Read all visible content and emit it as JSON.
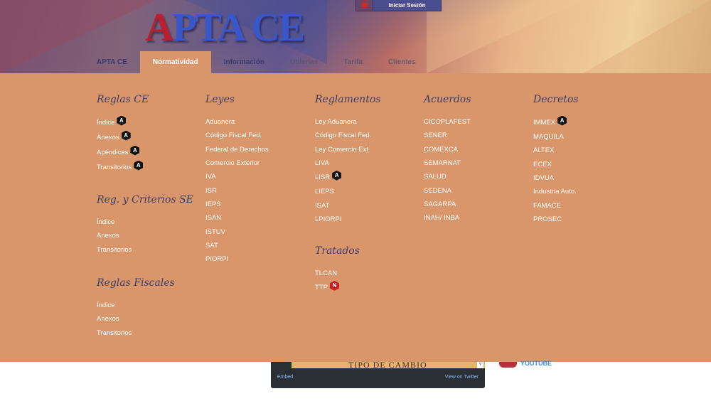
{
  "brand": {
    "logo_first": "A",
    "logo_rest": "PTA CE"
  },
  "login": {
    "label": "Iniciar Sesión",
    "icon": "lock-icon"
  },
  "nav": [
    {
      "label": "APTA CE",
      "state": "normal"
    },
    {
      "label": "Normatividad",
      "state": "active"
    },
    {
      "label": "Información",
      "state": "normal"
    },
    {
      "label": "Utilerías",
      "state": "faded"
    },
    {
      "label": "Tarifa",
      "state": "faded"
    },
    {
      "label": "Clientes",
      "state": "faded"
    }
  ],
  "menu": {
    "reglas_ce": {
      "title": "Reglas CE",
      "items": [
        {
          "label": "Índice",
          "badge": "A"
        },
        {
          "label": "Anexos",
          "badge": "A"
        },
        {
          "label": "Apéndices",
          "badge": "A"
        },
        {
          "label": "Transitorios",
          "badge": "A"
        }
      ]
    },
    "reg_criterios": {
      "title": "Reg. y Criterios SE",
      "items": [
        {
          "label": "Índice"
        },
        {
          "label": "Anexos"
        },
        {
          "label": "Transitorios"
        }
      ]
    },
    "reglas_fiscales": {
      "title": "Reglas Fiscales",
      "items": [
        {
          "label": "Índice"
        },
        {
          "label": "Anexos"
        },
        {
          "label": "Transitorios"
        }
      ]
    },
    "leyes": {
      "title": "Leyes",
      "items": [
        {
          "label": "Aduanera"
        },
        {
          "label": "Código Fiscal Fed."
        },
        {
          "label": "Federal de Derechos"
        },
        {
          "label": "Comercio Exterior"
        },
        {
          "label": "IVA"
        },
        {
          "label": "ISR"
        },
        {
          "label": "IEPS"
        },
        {
          "label": "ISAN"
        },
        {
          "label": "ISTUV"
        },
        {
          "label": "SAT"
        },
        {
          "label": "PIORPI"
        }
      ]
    },
    "reglamentos": {
      "title": "Reglamentos",
      "items": [
        {
          "label": "Ley Aduanera"
        },
        {
          "label": "Código Fiscal Fed."
        },
        {
          "label": "Ley Comercio Ext."
        },
        {
          "label": "LIVA"
        },
        {
          "label": "LISR",
          "badge": "A"
        },
        {
          "label": "LIEPS"
        },
        {
          "label": "ISAT"
        },
        {
          "label": "LPIORPI"
        }
      ]
    },
    "tratados": {
      "title": "Tratados",
      "items": [
        {
          "label": "TLCAN"
        },
        {
          "label": "TTP",
          "badge": "N"
        }
      ]
    },
    "acuerdos": {
      "title": "Acuerdos",
      "items": [
        {
          "label": "CICOPLAFEST"
        },
        {
          "label": "SENER"
        },
        {
          "label": "COMEXCA"
        },
        {
          "label": "SEMARNAT"
        },
        {
          "label": "SALUD"
        },
        {
          "label": "SEDENA"
        },
        {
          "label": "SAGARPA"
        },
        {
          "label": "INAH/ INBA"
        }
      ]
    },
    "decretos": {
      "title": "Decretos",
      "items": [
        {
          "label": "IMMEX",
          "badge": "A"
        },
        {
          "label": "MAQUILA"
        },
        {
          "label": "ALTEX"
        },
        {
          "label": "ECEX"
        },
        {
          "label": "IDVUA"
        },
        {
          "label": "Industria Auto."
        },
        {
          "label": "FAMACE"
        },
        {
          "label": "PROSEC"
        }
      ]
    }
  },
  "twitter_widget": {
    "banner_title": "TIPO DE CAMBIO",
    "embed_label": "Embed",
    "view_label": "View on Twitter"
  },
  "social": {
    "youtube_label": "YOUTUBE",
    "icon": "youtube-icon"
  }
}
